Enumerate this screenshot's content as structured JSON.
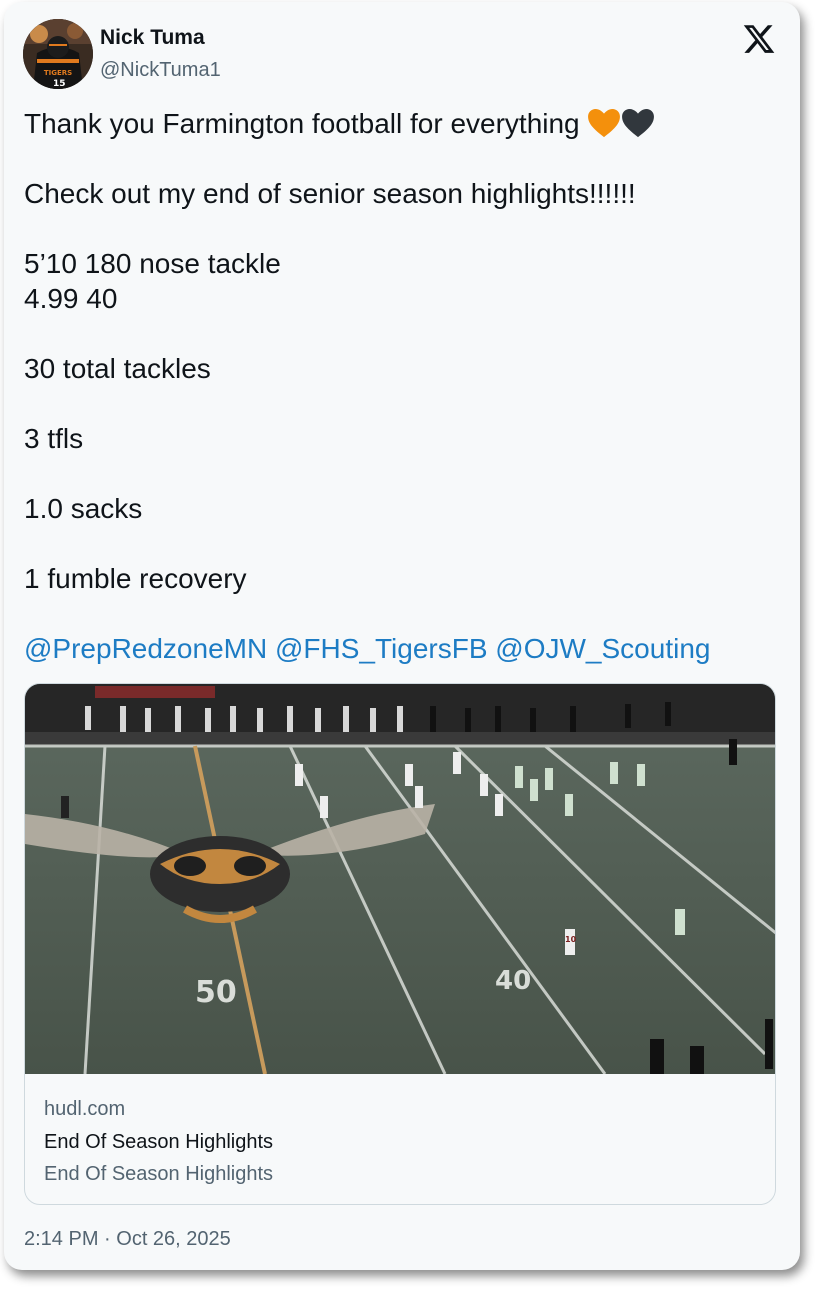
{
  "author": {
    "name": "Nick Tuma",
    "handle": "@NickTuma1",
    "avatar_jersey_text": "TIGERS"
  },
  "tweet": {
    "line1": "Thank you Farmington football for everything ",
    "line1_emoji": [
      "orange-heart",
      "black-heart"
    ],
    "line2": "Check out my end of senior season highlights!!!!!!",
    "line3": "5’10 180 nose tackle",
    "line4": "4.99 40",
    "line5": "30 total tackles",
    "line6": "3 tfls",
    "line7": "1.0 sacks",
    "line8": "1 fumble recovery",
    "mentions": [
      "@PrepRedzoneMN",
      "@FHS_TigersFB",
      "@OJW_Scouting"
    ]
  },
  "link_card": {
    "domain": "hudl.com",
    "title": "End Of Season Highlights",
    "description": "End Of Season Highlights",
    "image_yard_50": "50",
    "image_yard_40": "40",
    "image_jersey": "10"
  },
  "timestamp": "2:14 PM · Oct 26, 2025",
  "colors": {
    "mention": "#1d7cc4",
    "secondary_text": "#536471",
    "card_background": "#f7f9fa",
    "orange_heart": "#f4900c",
    "black_heart": "#31373d"
  }
}
